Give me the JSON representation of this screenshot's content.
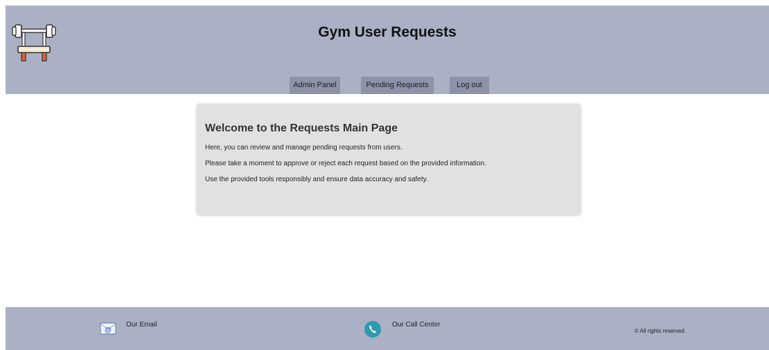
{
  "header": {
    "title": "Gym User Requests",
    "logo_icon": "dumbbell-bench-icon",
    "background_color": "#abb0c4"
  },
  "nav": {
    "items": [
      {
        "label": "Admin Panel"
      },
      {
        "label": "Pending Requests"
      },
      {
        "label": "Log out"
      }
    ],
    "button_color": "#8d92a9"
  },
  "main": {
    "heading": "Welcome to the Requests Main Page",
    "lines": [
      "Here, you can review and manage pending requests from users.",
      "Please take a moment to approve or reject each request based on the provided information.",
      "Use the provided tools responsibly and ensure data accuracy and safety."
    ],
    "card_color": "#e1e1e1"
  },
  "footer": {
    "email": {
      "label": "Our Email",
      "icon": "email-icon"
    },
    "call_center": {
      "label": "Our Call Center",
      "icon": "phone-icon"
    },
    "copyright": "© All rights reserved."
  }
}
